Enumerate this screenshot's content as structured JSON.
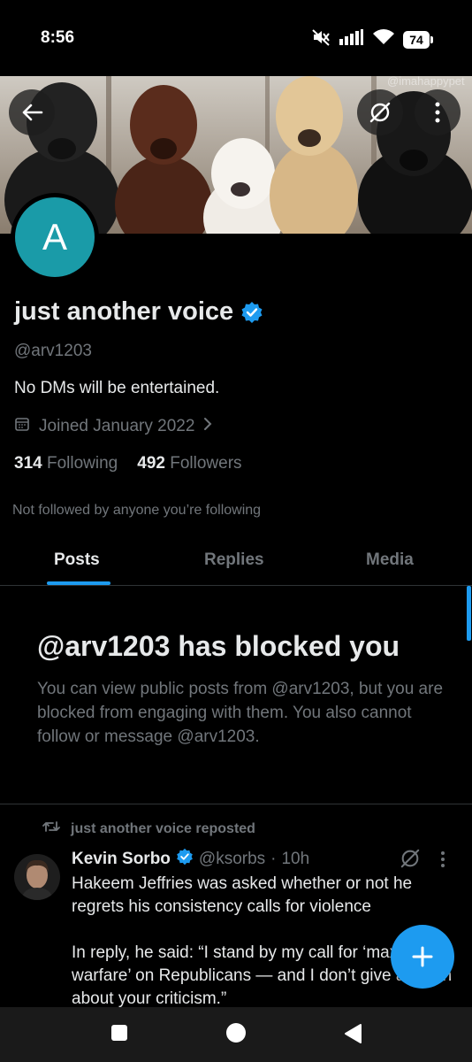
{
  "status_bar": {
    "time": "8:56",
    "battery": "74",
    "icons": [
      "mute-icon",
      "signal-icon",
      "wifi-icon",
      "battery-icon"
    ]
  },
  "banner": {
    "watermark": "@imahappypet",
    "buttons": [
      "back-arrow-icon",
      "grok-icon",
      "more-vertical-icon"
    ]
  },
  "profile": {
    "avatar_letter": "A",
    "avatar_color": "#1a9ba8",
    "name": "just another voice",
    "verified": true,
    "handle": "@arv1203",
    "bio": "No DMs will be entertained.",
    "joined": "Joined January 2022",
    "following_count": "314",
    "following_label": "Following",
    "followers_count": "492",
    "followers_label": "Followers",
    "not_followed_text": "Not followed by anyone you’re following"
  },
  "tabs": [
    {
      "label": "Posts",
      "active": true
    },
    {
      "label": "Replies",
      "active": false
    },
    {
      "label": "Media",
      "active": false
    }
  ],
  "blocked": {
    "title": "@arv1203 has blocked you",
    "description": "You can view public posts from @arv1203, but you are blocked from engaging with them. You also cannot follow or message @arv1203."
  },
  "post": {
    "repost_label": "just another voice reposted",
    "author": "Kevin Sorbo",
    "handle": "@ksorbs",
    "separator": "·",
    "time": "10h",
    "text": "Hakeem Jeffries was asked whether or not he regrets his consistency calls for violence\n\nIn reply, he said: “I stand by my call for ‘maximum warfare’ on Republicans — and I don’t give a damn about your criticism.”"
  },
  "colors": {
    "accent": "#1d9bf0",
    "background": "#000000",
    "text_primary": "#e7e9ea",
    "text_secondary": "#71767b",
    "divider": "#2f3336"
  },
  "nav_bar": [
    "recents-square-icon",
    "home-circle-icon",
    "back-triangle-icon"
  ]
}
